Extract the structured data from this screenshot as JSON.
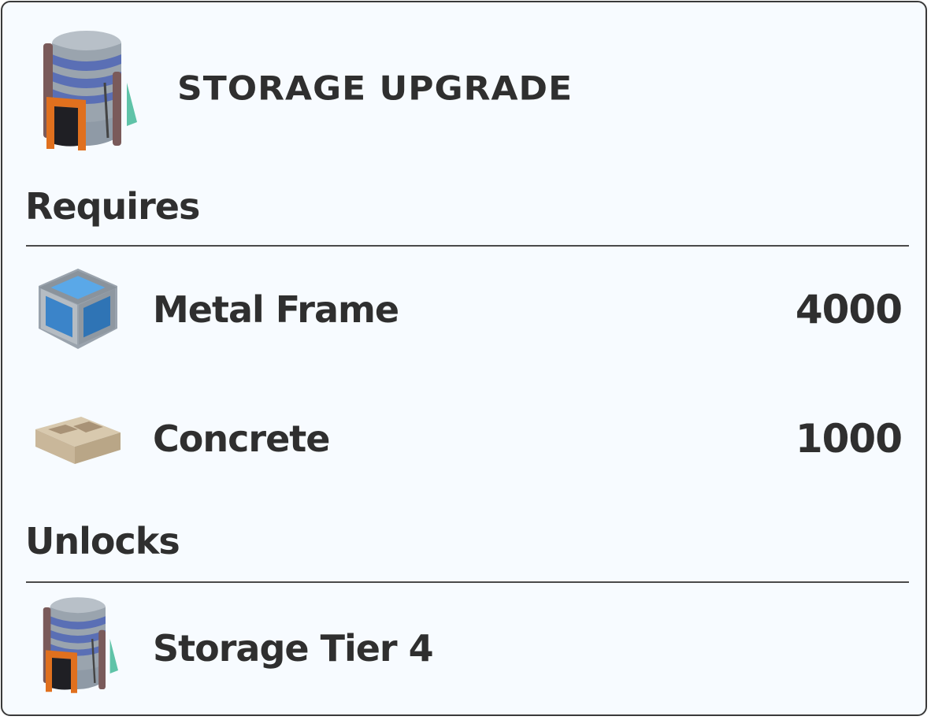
{
  "header": {
    "title": "STORAGE UPGRADE",
    "icon": "storage-silo-icon"
  },
  "requires": {
    "heading": "Requires",
    "items": [
      {
        "name": "Metal Frame",
        "quantity": "4000",
        "icon": "metal-frame-icon"
      },
      {
        "name": "Concrete",
        "quantity": "1000",
        "icon": "concrete-block-icon"
      }
    ]
  },
  "unlocks": {
    "heading": "Unlocks",
    "items": [
      {
        "name": "Storage Tier 4",
        "icon": "storage-silo-icon"
      }
    ]
  },
  "colors": {
    "background": "#f7fbff",
    "border": "#3a3a3a",
    "text": "#2f2f2f",
    "accent_orange": "#e0701e",
    "silo_blue": "#5a6fb5",
    "frame_blue": "#4a90d9"
  }
}
